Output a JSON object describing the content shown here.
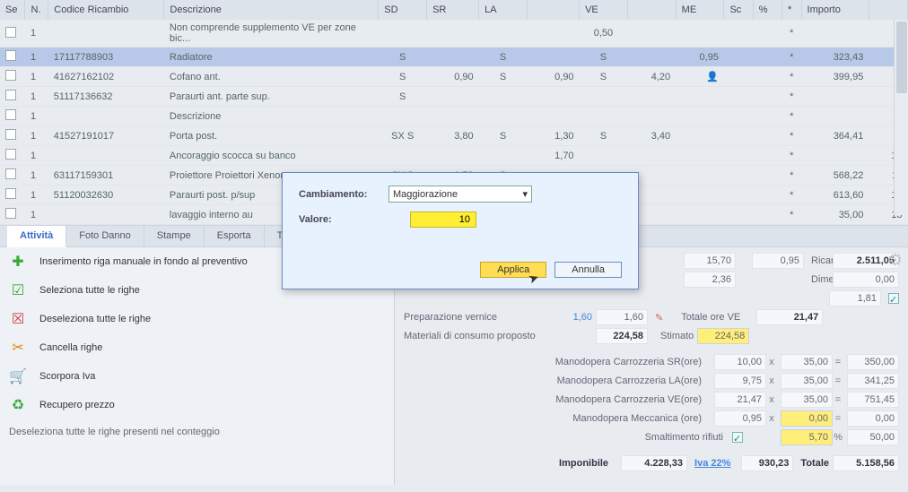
{
  "headers": {
    "se": "Se",
    "n": "N.",
    "code": "Codice Ricambio",
    "desc": "Descrizione",
    "sd": "SD",
    "sr": "SR",
    "la": "LA",
    "ve": "VE",
    "me": "ME",
    "sc": "Sc",
    "pct": "%",
    "star": "*",
    "imp": "Importo"
  },
  "rows": [
    {
      "n": "1",
      "code": "",
      "desc": "Non comprende supplemento VE per zone bic...",
      "sd": "",
      "sr": "",
      "la": "",
      "lav": "",
      "ve": "0,50",
      "me": "",
      "imp": "",
      "idx": "4"
    },
    {
      "n": "1",
      "code": "17117788903",
      "desc": "Radiatore",
      "sd": "S",
      "sr": "",
      "la": "S",
      "lav": "",
      "ve": "S",
      "me": "0,95",
      "imp": "323,43",
      "idx": "5",
      "hl": true
    },
    {
      "n": "1",
      "code": "41627162102",
      "desc": "Cofano ant.",
      "sd": "S",
      "sr": "0,90",
      "la": "S",
      "lav": "0,90",
      "ve": "S",
      "vev": "4,20",
      "me": "",
      "imp": "399,95",
      "idx": "6",
      "person": true
    },
    {
      "n": "1",
      "code": "51117136632",
      "desc": "Paraurti ant. parte sup.",
      "sd": "S",
      "sr": "",
      "la": "",
      "lav": "",
      "ve": "",
      "me": "",
      "imp": "",
      "idx": "7"
    },
    {
      "n": "1",
      "code": "",
      "desc": "Descrizione",
      "sd": "",
      "sr": "",
      "la": "",
      "lav": "",
      "ve": "",
      "me": "",
      "imp": "",
      "idx": "8"
    },
    {
      "n": "1",
      "code": "41527191017",
      "desc": "Porta post.",
      "sd": "SX    S",
      "sr": "3,80",
      "la": "S",
      "lav": "1,30",
      "ve": "S",
      "vev": "3,40",
      "me": "",
      "imp": "364,41",
      "idx": "9"
    },
    {
      "n": "1",
      "code": "",
      "desc": "Ancoraggio scocca su banco",
      "sd": "",
      "sr": "",
      "la": "",
      "lav": "1,70",
      "ve": "",
      "me": "",
      "imp": "",
      "idx": "10"
    },
    {
      "n": "1",
      "code": "63117159301",
      "desc": "Proiettore Proiettori Xenon",
      "sd": "SX    S",
      "sr": "1,50",
      "la": "S",
      "lav": "",
      "ve": "",
      "me": "",
      "imp": "568,22",
      "idx": "11"
    },
    {
      "n": "1",
      "code": "51120032630",
      "desc": "Paraurti post. p/sup",
      "sd": "",
      "sr": "",
      "la": "",
      "lav": "",
      "ve": "",
      "me": "",
      "imp": "613,60",
      "idx": "12"
    },
    {
      "n": "1",
      "code": "",
      "desc": "lavaggio interno au",
      "sd": "",
      "sr": "",
      "la": "",
      "lav": "",
      "ve": "",
      "me": "",
      "imp": "35,00",
      "idx": "13"
    }
  ],
  "tabs": {
    "attivita": "Attività",
    "foto": "Foto Danno",
    "stampe": "Stampe",
    "esporta": "Esporta",
    "totali": "Totali"
  },
  "actions": {
    "insert": "Inserimento riga manuale in fondo al preventivo",
    "select": "Seleziona tutte le righe",
    "deselect": "Deseleziona tutte le righe",
    "delete": "Cancella righe",
    "scorpora": "Scorpora Iva",
    "recupero": "Recupero prezzo"
  },
  "hint": "Deseleziona tutte le righe presenti nel conteggio",
  "summary": {
    "r1": {
      "v1": "15,70",
      "v2": "0,95",
      "l": "Ricambi",
      "t": "2.511,05"
    },
    "r2": {
      "v1": "2,36",
      "l": "Dime",
      "t": "0,00"
    },
    "r3": {
      "v1": "1,81"
    },
    "prep": {
      "l": "Preparazione vernice",
      "b": "1,60",
      "v": "1,60",
      "tl": "Totale ore VE",
      "t": "21,47"
    },
    "mat": {
      "l": "Materiali di consumo proposto",
      "v": "224,58",
      "sl": "Stimato",
      "sv": "224,58"
    },
    "m1": {
      "l": "Manodopera Carrozzeria SR(ore)",
      "h": "10,00",
      "r": "35,00",
      "t": "350,00"
    },
    "m2": {
      "l": "Manodopera Carrozzeria LA(ore)",
      "h": "9,75",
      "r": "35,00",
      "t": "341,25"
    },
    "m3": {
      "l": "Manodopera Carrozzeria VE(ore)",
      "h": "21,47",
      "r": "35,00",
      "t": "751,45"
    },
    "m4": {
      "l": "Manodopera Meccanica (ore)",
      "h": "0,95",
      "r": "0,00",
      "t": "0,00"
    },
    "sm": {
      "l": "Smaltimento rifiuti",
      "r": "5,70",
      "t": "50,00"
    },
    "tot": {
      "il": "Imponibile",
      "iv": "4.228,33",
      "iva": "Iva 22%",
      "ivav": "930,23",
      "tl": "Totale",
      "tv": "5.158,56"
    }
  },
  "modal": {
    "l1": "Cambiamento:",
    "sel": "Maggiorazione",
    "l2": "Valore:",
    "val": "10",
    "apply": "Applica",
    "cancel": "Annulla"
  }
}
